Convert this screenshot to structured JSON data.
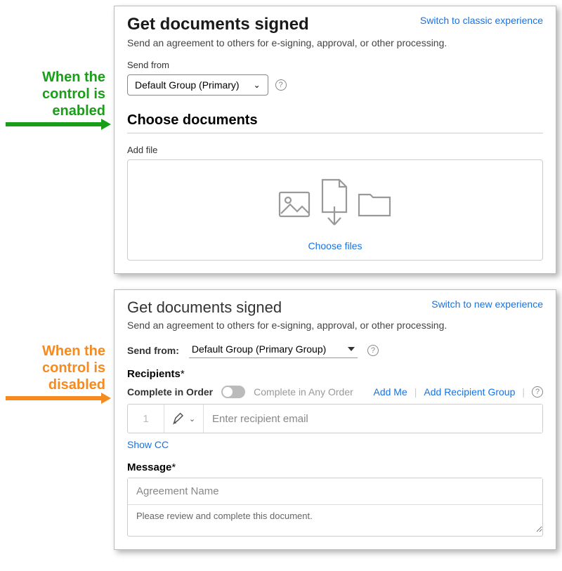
{
  "annotation_enabled": "When the control is enabled",
  "annotation_disabled": "When the control is disabled",
  "panel1": {
    "title": "Get documents signed",
    "switch_link": "Switch to classic experience",
    "subtitle": "Send an agreement to others for e-signing, approval, or other processing.",
    "send_from_label": "Send from",
    "send_from_value": "Default Group (Primary)",
    "choose_docs": "Choose documents",
    "add_file_label": "Add file",
    "choose_files": "Choose files"
  },
  "panel2": {
    "title": "Get documents signed",
    "switch_link": "Switch to new experience",
    "subtitle": "Send an agreement to others for e-signing, approval, or other processing.",
    "send_from_label": "Send from:",
    "send_from_value": "Default Group (Primary Group)",
    "recipients_label": "Recipients",
    "complete_in_order": "Complete in Order",
    "complete_any_order": "Complete in Any Order",
    "add_me": "Add Me",
    "add_group": "Add Recipient Group",
    "recipient_num": "1",
    "recipient_placeholder": "Enter recipient email",
    "show_cc": "Show CC",
    "message_label": "Message",
    "agreement_name_placeholder": "Agreement Name",
    "message_body": "Please review and complete this document."
  }
}
